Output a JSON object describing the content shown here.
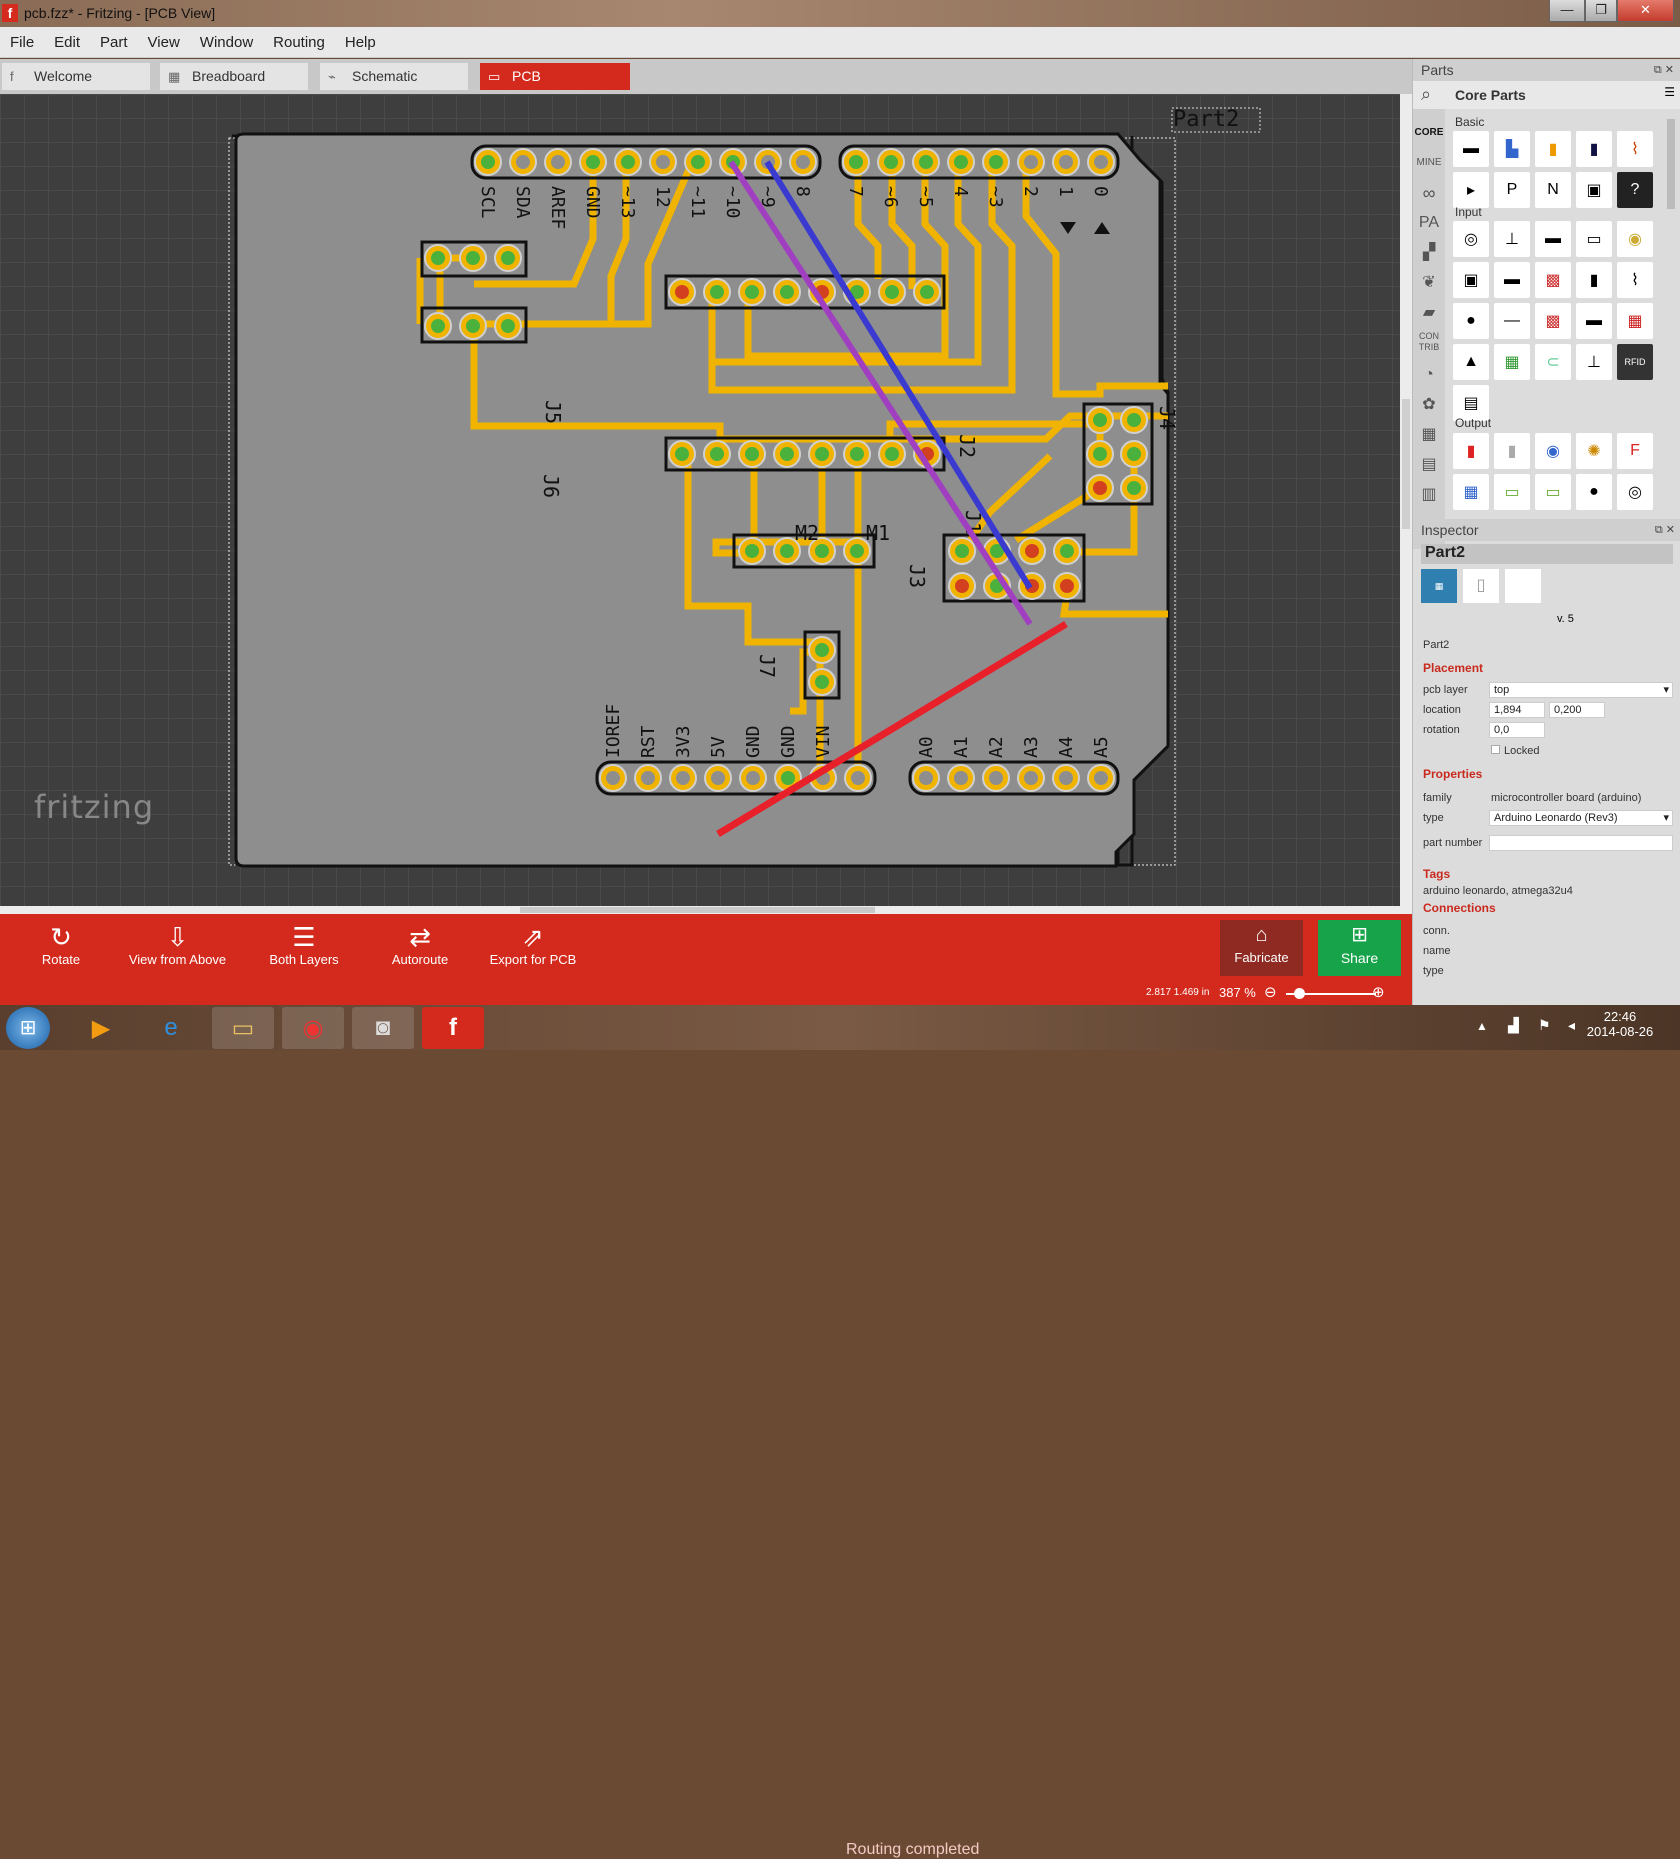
{
  "window": {
    "title": "pcb.fzz* - Fritzing - [PCB View]",
    "app_icon": "f",
    "minimize": "—",
    "maximize": "❐",
    "close": "✕"
  },
  "menu": [
    "File",
    "Edit",
    "Part",
    "View",
    "Window",
    "Routing",
    "Help"
  ],
  "tabs": [
    {
      "label": "Welcome",
      "icon": "f"
    },
    {
      "label": "Breadboard",
      "icon": "▦"
    },
    {
      "label": "Schematic",
      "icon": "⌁"
    },
    {
      "label": "PCB",
      "icon": "▭"
    }
  ],
  "canvas": {
    "part_label": "Part2",
    "watermark": "fritzing",
    "top_header_labels": [
      "SCL",
      "SDA",
      "AREF",
      "GND",
      "~13",
      "12",
      "~11",
      "~10",
      "~9",
      "8",
      "7",
      "~6",
      "~5",
      "4",
      "~3",
      "2",
      "1",
      "0"
    ],
    "power_labels": [
      "IOREF",
      "RST",
      "3V3",
      "5V",
      "GND",
      "GND",
      "VIN"
    ],
    "analog_labels": [
      "A0",
      "A1",
      "A2",
      "A3",
      "A4",
      "A5"
    ],
    "refdes": [
      "J5",
      "J6",
      "J2",
      "J4",
      "M2",
      "M1",
      "J3",
      "J1",
      "J7"
    ],
    "colors": {
      "board": "#8e8e8e",
      "trace": "#f0b400",
      "pad_inner": "#4ab23c",
      "pad_red": "#d24020",
      "ratsnest_purple": "#a040c0",
      "ratsnest_blue": "#3a3ad0",
      "ratsnest_red": "#e8202a"
    }
  },
  "toolbar": {
    "rotate": "Rotate",
    "view_from_above": "View from Above",
    "both_layers": "Both Layers",
    "autoroute": "Autoroute",
    "export": "Export for PCB",
    "status": "Routing completed",
    "fabricate": "Fabricate",
    "share": "Share"
  },
  "zoom": {
    "coords": "2.817 1.469 in",
    "percent": "387 %"
  },
  "parts_panel": {
    "title": "Parts",
    "bin": "Core Parts",
    "side_tabs": [
      "CORE",
      "MINE",
      "∞",
      "PA",
      "",
      "",
      "",
      "CON TRIB"
    ],
    "sections": [
      "Basic",
      "Input",
      "Output"
    ]
  },
  "inspector": {
    "title": "Inspector",
    "part_name": "Part2",
    "version": "v. 5",
    "part_caption": "Part2",
    "placement_header": "Placement",
    "pcb_layer_label": "pcb layer",
    "pcb_layer_value": "top",
    "location_label": "location",
    "location_x": "1,894",
    "location_y": "0,200",
    "rotation_label": "rotation",
    "rotation_value": "0,0",
    "locked_label": "Locked",
    "properties_header": "Properties",
    "family_label": "family",
    "family_value": "microcontroller board (arduino)",
    "type_label": "type",
    "type_value": "Arduino Leonardo (Rev3)",
    "part_number_label": "part number",
    "tags_header": "Tags",
    "tags_value": "arduino leonardo, atmega32u4",
    "connections_header": "Connections",
    "conn_label": "conn.",
    "name_label": "name",
    "ctype_label": "type"
  },
  "taskbar": {
    "time": "22:46",
    "date": "2014-08-26"
  }
}
